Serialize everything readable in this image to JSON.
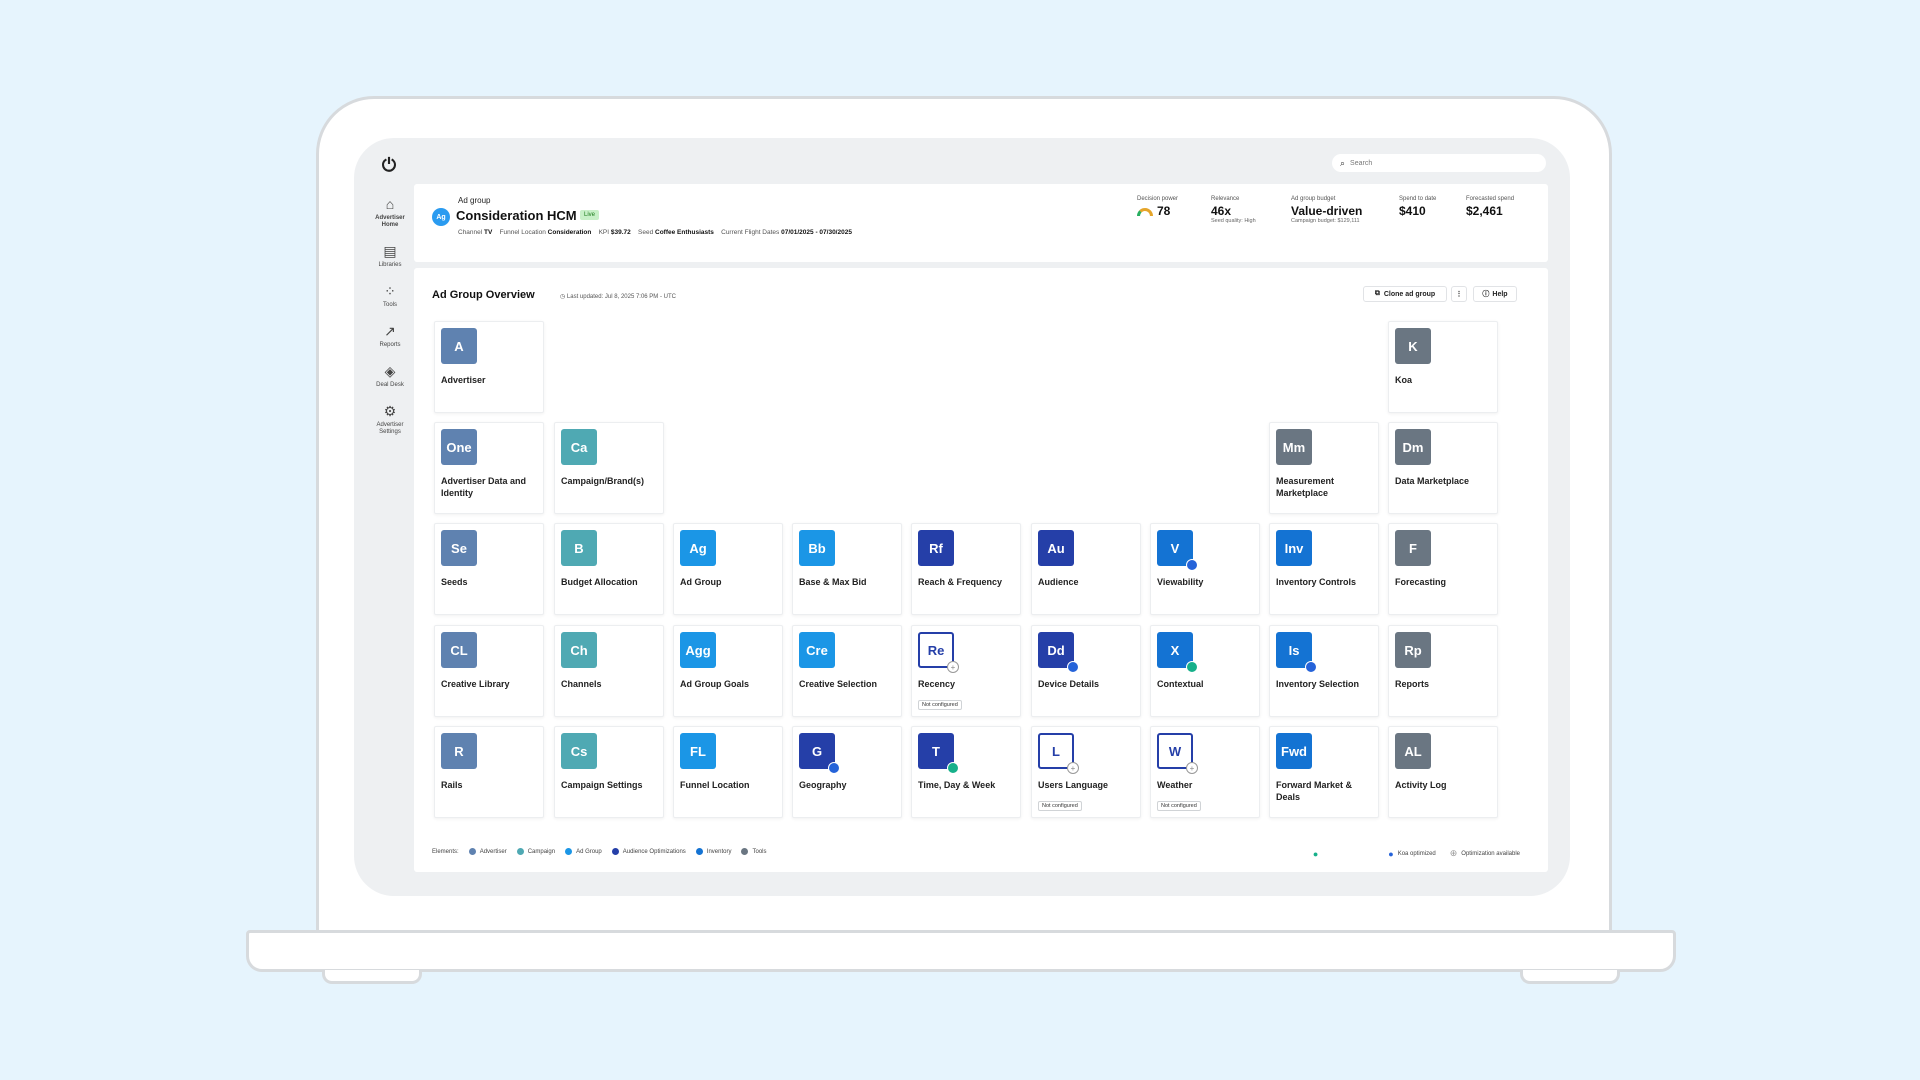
{
  "sidebar": {
    "items": [
      {
        "icon": "home-icon",
        "label": "Advertiser Home",
        "active": true
      },
      {
        "icon": "libraries-icon",
        "label": "Libraries"
      },
      {
        "icon": "tools-icon",
        "label": "Tools"
      },
      {
        "icon": "reports-icon",
        "label": "Reports"
      },
      {
        "icon": "deal-desk-icon",
        "label": "Deal Desk"
      },
      {
        "icon": "advertiser-settings-icon",
        "label": "Advertiser Settings"
      }
    ]
  },
  "search": {
    "placeholder": "Search"
  },
  "header": {
    "badge": "Ag",
    "kind": "Ad group",
    "name": "Consideration HCM",
    "status": "Live",
    "meta": {
      "channel_label": "Channel",
      "channel": "TV",
      "funnel_label": "Funnel Location",
      "funnel": "Consideration",
      "kpi_label": "KPI",
      "kpi": "$39.72",
      "seed_label": "Seed",
      "seed": "Coffee Enthusiasts",
      "dates_label": "Current Flight Dates",
      "dates": "07/01/2025 - 07/30/2025"
    },
    "metrics": {
      "decision_power": {
        "label": "Decision power",
        "value": "78"
      },
      "relevance": {
        "label": "Relevance",
        "value": "46x",
        "sub": "Seed quality: High"
      },
      "budget": {
        "label": "Ad group budget",
        "value": "Value-driven",
        "sub": "Campaign budget: $129,111"
      },
      "spend": {
        "label": "Spend to date",
        "value": "$410"
      },
      "forecast": {
        "label": "Forecasted spend",
        "value": "$2,461"
      }
    }
  },
  "overview": {
    "title": "Ad Group Overview",
    "updated": "Last updated: Jul 8, 2025 7:06 PM - UTC",
    "clone_label": "Clone ad group",
    "more_label": "⋮",
    "help_label": "Help"
  },
  "colors": {
    "advertiser": "#5f82b0",
    "campaign": "#4fa9b3",
    "adgroup": "#1b96e6",
    "audience": "#253fa8",
    "inventory": "#1473d3",
    "tools": "#6a7682"
  },
  "tiles": [
    {
      "abbr": "A",
      "label": "Advertiser",
      "category": "advertiser"
    },
    {
      "abbr": "K",
      "label": "Koa",
      "category": "tools"
    },
    {
      "abbr": "One",
      "label": "Advertiser Data and Identity",
      "category": "advertiser"
    },
    {
      "abbr": "Ca",
      "label": "Campaign/Brand(s)",
      "category": "campaign"
    },
    {
      "abbr": "Mm",
      "label": "Measurement Marketplace",
      "category": "tools"
    },
    {
      "abbr": "Dm",
      "label": "Data Marketplace",
      "category": "tools"
    },
    {
      "abbr": "Se",
      "label": "Seeds",
      "category": "advertiser"
    },
    {
      "abbr": "B",
      "label": "Budget Allocation",
      "category": "campaign"
    },
    {
      "abbr": "Ag",
      "label": "Ad Group",
      "category": "adgroup"
    },
    {
      "abbr": "Bb",
      "label": "Base & Max Bid",
      "category": "adgroup"
    },
    {
      "abbr": "Rf",
      "label": "Reach & Frequency",
      "category": "audience"
    },
    {
      "abbr": "Au",
      "label": "Audience",
      "category": "audience"
    },
    {
      "abbr": "V",
      "label": "Viewability",
      "category": "inventory",
      "marker": "koa"
    },
    {
      "abbr": "Inv",
      "label": "Inventory Controls",
      "category": "inventory"
    },
    {
      "abbr": "F",
      "label": "Forecasting",
      "category": "tools"
    },
    {
      "abbr": "CL",
      "label": "Creative Library",
      "category": "advertiser"
    },
    {
      "abbr": "Ch",
      "label": "Channels",
      "category": "campaign"
    },
    {
      "abbr": "Agg",
      "label": "Ad Group Goals",
      "category": "adgroup"
    },
    {
      "abbr": "Cre",
      "label": "Creative Selection",
      "category": "adgroup"
    },
    {
      "abbr": "Re",
      "label": "Recency",
      "category": "audience",
      "outline": true,
      "marker": "opt",
      "note": "Not configured"
    },
    {
      "abbr": "Dd",
      "label": "Device Details",
      "category": "audience",
      "marker": "koa"
    },
    {
      "abbr": "X",
      "label": "Contextual",
      "category": "inventory",
      "marker": "user"
    },
    {
      "abbr": "Is",
      "label": "Inventory Selection",
      "category": "inventory",
      "marker": "koa"
    },
    {
      "abbr": "Rp",
      "label": "Reports",
      "category": "tools"
    },
    {
      "abbr": "R",
      "label": "Rails",
      "category": "advertiser"
    },
    {
      "abbr": "Cs",
      "label": "Campaign Settings",
      "category": "campaign"
    },
    {
      "abbr": "FL",
      "label": "Funnel Location",
      "category": "adgroup"
    },
    {
      "abbr": "G",
      "label": "Geography",
      "category": "audience",
      "marker": "koa"
    },
    {
      "abbr": "T",
      "label": "Time, Day & Week",
      "category": "audience",
      "marker": "user"
    },
    {
      "abbr": "L",
      "label": "Users Language",
      "category": "audience",
      "outline": true,
      "marker": "opt",
      "note": "Not configured"
    },
    {
      "abbr": "W",
      "label": "Weather",
      "category": "audience",
      "outline": true,
      "marker": "opt",
      "note": "Not configured"
    },
    {
      "abbr": "Fwd",
      "label": "Forward Market & Deals",
      "category": "inventory"
    },
    {
      "abbr": "AL",
      "label": "Activity Log",
      "category": "tools"
    }
  ],
  "legend": {
    "title": "Elements:",
    "items": [
      {
        "label": "Advertiser",
        "category": "advertiser"
      },
      {
        "label": "Campaign",
        "category": "campaign"
      },
      {
        "label": "Ad Group",
        "category": "adgroup"
      },
      {
        "label": "Audience Optimizations",
        "category": "audience"
      },
      {
        "label": "Inventory",
        "category": "inventory"
      },
      {
        "label": "Tools",
        "category": "tools"
      }
    ],
    "koa_label": "Koa optimized",
    "opt_label": "Optimization available"
  }
}
